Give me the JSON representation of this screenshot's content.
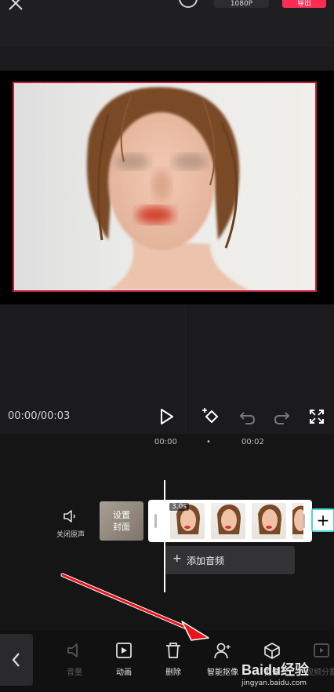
{
  "top_bar": {
    "resolution": "1080P",
    "export": "导出"
  },
  "player": {
    "timecode": "00:00/00:03"
  },
  "timeline": {
    "ticks": [
      "00:00",
      "•",
      "00:02"
    ],
    "mute_label": "关闭原声",
    "cover_label_line1": "设置",
    "cover_label_line2": "封面",
    "clip_duration": "3.0s",
    "add_audio": "添加音频",
    "add_clip": "+"
  },
  "toolbar": {
    "items": [
      {
        "label": "音量",
        "icon": "volume-icon",
        "enabled": false
      },
      {
        "label": "动画",
        "icon": "animation-icon",
        "enabled": true
      },
      {
        "label": "删除",
        "icon": "delete-icon",
        "enabled": true
      },
      {
        "label": "智能抠像",
        "icon": "smart-cutout-icon",
        "enabled": true
      },
      {
        "label": "抠像",
        "icon": "cube-icon",
        "enabled": true
      },
      {
        "label": "视频分割",
        "icon": "split-icon",
        "enabled": false
      }
    ]
  },
  "watermark": {
    "brand": "Baidu经验",
    "url": "jingyan.baidu.com"
  },
  "colors": {
    "accent_red": "#fe2c55",
    "preview_border": "#c21f3c",
    "clip_add_border": "#4ad9d9",
    "annotation_arrow": "#e8141a"
  }
}
